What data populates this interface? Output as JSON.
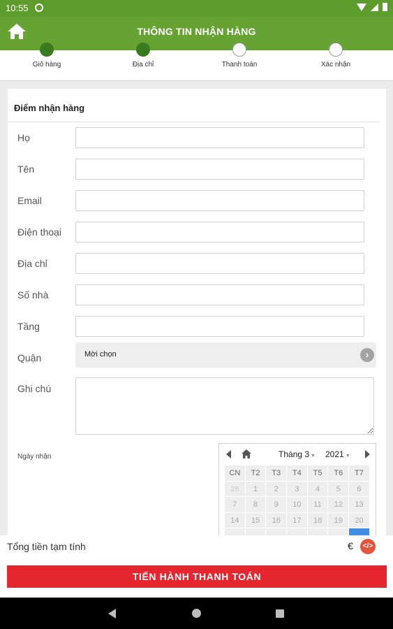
{
  "status_bar": {
    "time": "10:55",
    "icons": [
      "notification-icon",
      "wifi-icon",
      "signal-icon",
      "battery-icon"
    ]
  },
  "header": {
    "title": "THÔNG TIN NHẬN HÀNG",
    "home_icon": "home-icon",
    "background": "#66a332"
  },
  "steps": [
    {
      "label": "Giỏ hàng",
      "state": "done"
    },
    {
      "label": "Địa chỉ",
      "state": "done"
    },
    {
      "label": "Thanh toán",
      "state": "pending"
    },
    {
      "label": "Xác nhận",
      "state": "pending"
    }
  ],
  "form": {
    "section_title": "Điểm nhận hàng",
    "fields": [
      {
        "label": "Họ",
        "value": ""
      },
      {
        "label": "Tên",
        "value": ""
      },
      {
        "label": "Email",
        "value": ""
      },
      {
        "label": "Điện thoại",
        "value": ""
      },
      {
        "label": "Địa chỉ",
        "value": ""
      },
      {
        "label": "Số nhà",
        "value": ""
      },
      {
        "label": "Tầng",
        "value": ""
      }
    ],
    "district": {
      "label": "Quận",
      "value": "Mời chọn"
    },
    "note": {
      "label": "Ghi chú",
      "value": ""
    },
    "date_label": "Ngày nhận"
  },
  "calendar": {
    "month": "Tháng 3",
    "year": "2021",
    "weekdays": [
      "CN",
      "T2",
      "T3",
      "T4",
      "T5",
      "T6",
      "T7"
    ],
    "weeks": [
      [
        "28",
        "1",
        "2",
        "3",
        "4",
        "5",
        "6"
      ],
      [
        "7",
        "8",
        "9",
        "10",
        "11",
        "12",
        "13"
      ],
      [
        "14",
        "15",
        "16",
        "17",
        "18",
        "19",
        "20"
      ]
    ],
    "accent": "#3e8de0"
  },
  "footer": {
    "total_label": "Tổng tiền tạm tính",
    "total_value": "€",
    "pay_button": "TIẾN HÀNH THANH TOÁN",
    "pay_color": "#e5262e"
  }
}
